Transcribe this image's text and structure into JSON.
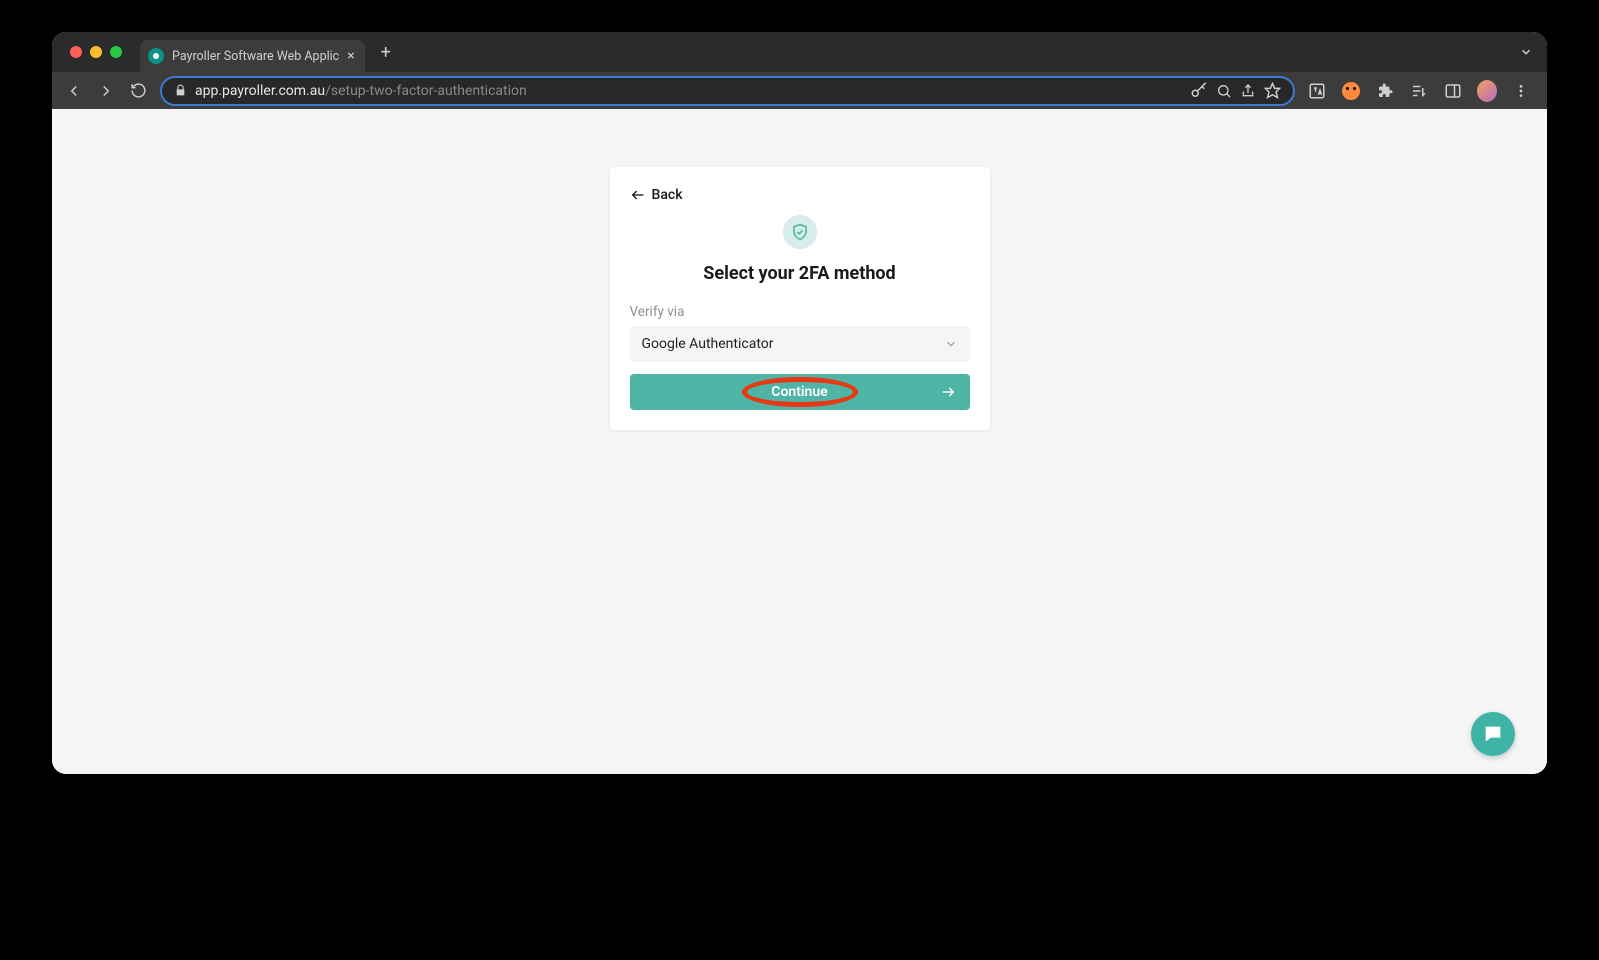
{
  "browser": {
    "tab_title": "Payroller Software Web Applic",
    "url_domain": "app.payroller.com.au",
    "url_path": "/setup-two-factor-authentication"
  },
  "card": {
    "back_label": "Back",
    "heading": "Select your 2FA method",
    "field_label": "Verify via",
    "select_value": "Google Authenticator",
    "continue_label": "Continue"
  }
}
